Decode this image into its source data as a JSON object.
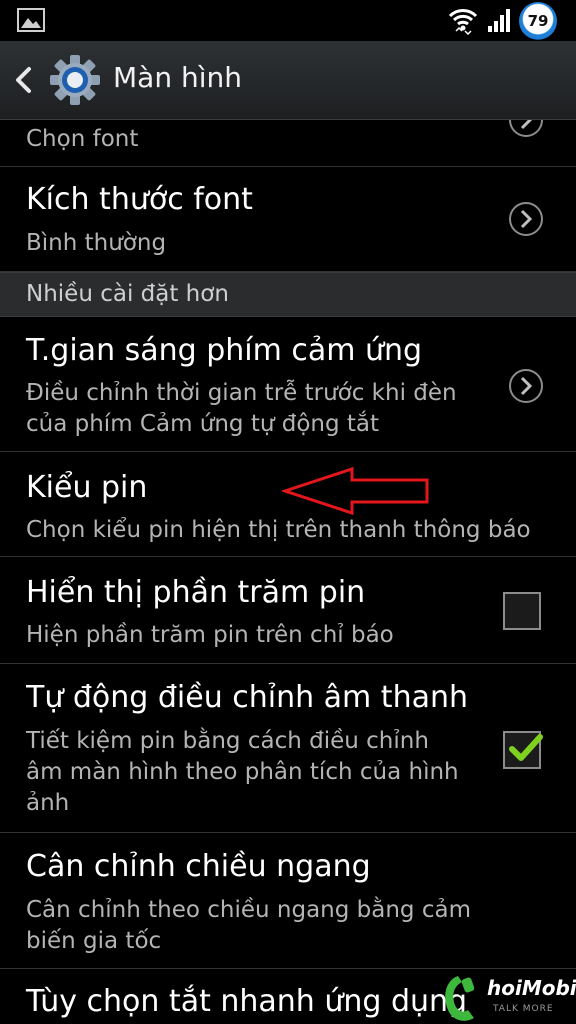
{
  "status_bar": {
    "battery_level": "79",
    "icons": [
      "gallery-icon",
      "wifi-icon",
      "signal-icon",
      "battery-icon"
    ]
  },
  "action_bar": {
    "title": "Màn hình",
    "icons": [
      "back-icon",
      "settings-gear-icon"
    ]
  },
  "settings": {
    "font_style_subtitle": "Chọn font",
    "font_size": {
      "title": "Kích thước font",
      "subtitle": "Bình thường"
    },
    "section_header": "Nhiều cài đặt hơn",
    "touch_key_light": {
      "title": "T.gian sáng phím cảm ứng",
      "subtitle_line1": "Điều chỉnh thời gian trễ trước khi đèn",
      "subtitle_line2": "của phím Cảm ứng tự động tắt"
    },
    "battery_style": {
      "title": "Kiểu pin",
      "subtitle": "Chọn kiểu pin hiện thị trên thanh thông báo"
    },
    "battery_percent": {
      "title": "Hiển thị phần trăm pin",
      "subtitle": "Hiện phần trăm pin trên chỉ báo",
      "checked": false
    },
    "auto_tone": {
      "title": "Tự động điều chỉnh âm thanh",
      "subtitle_line1": "Tiết kiệm pin bằng cách điều chỉnh",
      "subtitle_line2": "âm màn hình theo phân tích của hình",
      "subtitle_line3": "ảnh",
      "checked": true
    },
    "horizontal_calibration": {
      "title": "Cân chỉnh chiều ngang",
      "subtitle_line1": "Cân chỉnh theo chiều ngang bằng cảm",
      "subtitle_line2": "biến gia tốc"
    },
    "quick_off": {
      "title": "Tùy chọn tắt nhanh ứng dụng"
    }
  },
  "watermark": {
    "brand": "hoiMobile",
    "tagline": "TALK MORE"
  },
  "colors": {
    "accent_blue": "#1d7fd6",
    "check_green": "#7fd11f",
    "annotation_red": "#e3161b"
  }
}
